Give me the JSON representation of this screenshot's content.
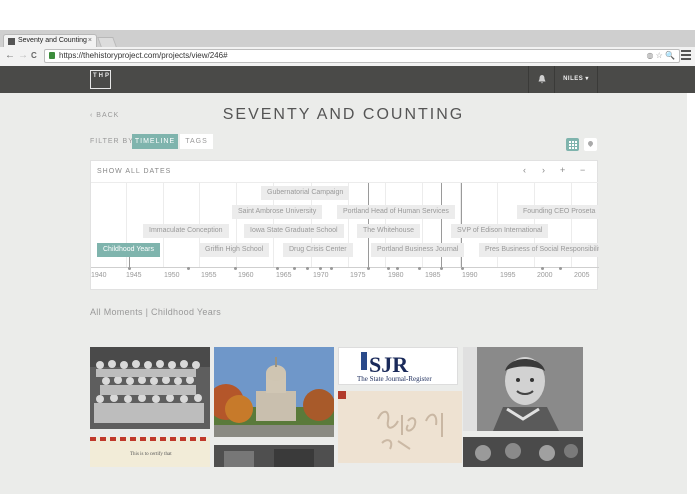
{
  "browser": {
    "tab_title": "Seventy and Counting",
    "tab_close": "×",
    "url": "https://thehistoryproject.com/projects/view/246#",
    "nav_back": "←",
    "nav_forward": "→",
    "nav_reload": "C",
    "url_icons": "◍ ☆ 🔍"
  },
  "appbar": {
    "logo_text": "THP",
    "bell_icon": "bell-icon",
    "user_label": "NILES ▾"
  },
  "page": {
    "back_label": "‹ BACK",
    "title": "SEVENTY AND COUNTING",
    "filter_label": "FILTER BY",
    "filter_timeline": "TIMELINE",
    "filter_tags": "TAGS",
    "breadcrumb": "All Moments  |  Childhood Years"
  },
  "timeline": {
    "show_all": "SHOW ALL DATES",
    "controls": [
      "‹",
      "›",
      "+",
      "−"
    ],
    "years": [
      "1940",
      "1945",
      "1950",
      "1955",
      "1960",
      "1965",
      "1970",
      "1975",
      "1980",
      "1985",
      "1990",
      "1995",
      "2000",
      "2005"
    ],
    "events": [
      {
        "label": "Gubernatorial Campaign",
        "active": false
      },
      {
        "label": "Saint Ambrose University",
        "active": false
      },
      {
        "label": "Portland Head of Human Services",
        "active": false
      },
      {
        "label": "Founding CEO Proseta",
        "active": false
      },
      {
        "label": "Immaculate Conception",
        "active": false
      },
      {
        "label": "Iowa State Graduate School",
        "active": false
      },
      {
        "label": "The Whitehouse",
        "active": false
      },
      {
        "label": "SVP of Edison International",
        "active": false
      },
      {
        "label": "Childhood Years",
        "active": true
      },
      {
        "label": "Griffin High School",
        "active": false
      },
      {
        "label": "Drug Crisis Center",
        "active": false
      },
      {
        "label": "Portland Business Journal",
        "active": false
      },
      {
        "label": "Pres Business of Social Responsibility",
        "active": false
      }
    ]
  },
  "moments": [
    {
      "name": "class-photo",
      "desc": "Black and white group class photo"
    },
    {
      "name": "capitol-building",
      "desc": "State capitol building with autumn trees"
    },
    {
      "name": "sjr-logo",
      "brand": "SJR",
      "sub": "The State Journal-Register"
    },
    {
      "name": "boy-portrait",
      "desc": "Black and white portrait of a boy"
    },
    {
      "name": "certificate",
      "text": "This is to certify that"
    },
    {
      "name": "handwritten-note",
      "desc": "Handwritten note"
    },
    {
      "name": "group-photo",
      "desc": "Black and white photo"
    }
  ],
  "colors": {
    "accent": "#7fb4ad",
    "appbar": "#4a4a48",
    "background": "#ebecea"
  }
}
